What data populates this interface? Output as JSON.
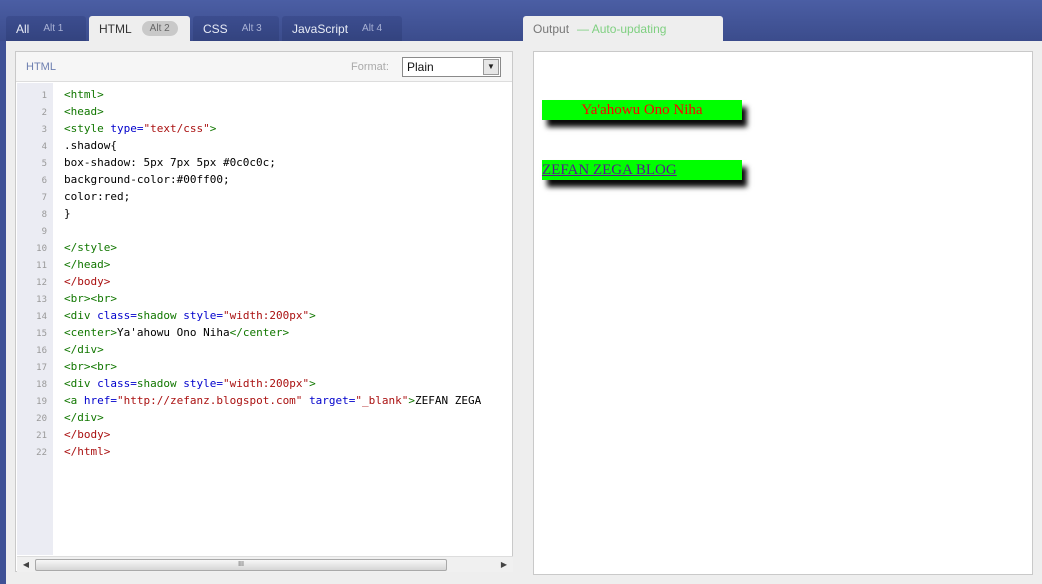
{
  "tabs": {
    "all": {
      "label": "All",
      "alt": "Alt 1"
    },
    "html": {
      "label": "HTML",
      "alt": "Alt 2"
    },
    "css": {
      "label": "CSS",
      "alt": "Alt 3"
    },
    "js": {
      "label": "JavaScript",
      "alt": "Alt 4"
    },
    "output": {
      "label": "Output",
      "status": "— Auto-updating"
    }
  },
  "editor": {
    "title": "HTML",
    "format_label": "Format:",
    "format_value": "Plain",
    "scroll_thumb": "III",
    "line_numbers": [
      "1",
      "2",
      "3",
      "4",
      "5",
      "6",
      "7",
      "8",
      "9",
      "10",
      "11",
      "12",
      "13",
      "14",
      "15",
      "16",
      "17",
      "18",
      "19",
      "20",
      "21",
      "22"
    ],
    "code_lines": [
      [
        {
          "c": "t-tag",
          "t": "<html>"
        }
      ],
      [
        {
          "c": "t-tag",
          "t": "<head>"
        }
      ],
      [
        {
          "c": "t-tag",
          "t": "<style "
        },
        {
          "c": "t-attr",
          "t": "type="
        },
        {
          "c": "t-str",
          "t": "\"text/css\""
        },
        {
          "c": "t-tag",
          "t": ">"
        }
      ],
      [
        {
          "c": "t-text",
          "t": ".shadow{"
        }
      ],
      [
        {
          "c": "t-text",
          "t": "box-shadow: 5px 7px 5px #0c0c0c;"
        }
      ],
      [
        {
          "c": "t-text",
          "t": "background-color:#00ff00;"
        }
      ],
      [
        {
          "c": "t-text",
          "t": "color:red;"
        }
      ],
      [
        {
          "c": "t-text",
          "t": "}"
        }
      ],
      [],
      [
        {
          "c": "t-tag",
          "t": "</style>"
        }
      ],
      [
        {
          "c": "t-tag",
          "t": "</head>"
        }
      ],
      [
        {
          "c": "t-kw",
          "t": "</body>"
        }
      ],
      [
        {
          "c": "t-tag",
          "t": "<br><br>"
        }
      ],
      [
        {
          "c": "t-tag",
          "t": "<div "
        },
        {
          "c": "t-attr",
          "t": "class="
        },
        {
          "c": "t-tag",
          "t": "shadow "
        },
        {
          "c": "t-attr",
          "t": "style="
        },
        {
          "c": "t-str",
          "t": "\"width:200px\""
        },
        {
          "c": "t-tag",
          "t": ">"
        }
      ],
      [
        {
          "c": "t-tag",
          "t": "<center>"
        },
        {
          "c": "t-text",
          "t": "Ya'ahowu Ono Niha"
        },
        {
          "c": "t-tag",
          "t": "</center>"
        }
      ],
      [
        {
          "c": "t-tag",
          "t": "</div>"
        }
      ],
      [
        {
          "c": "t-tag",
          "t": "<br><br>"
        }
      ],
      [
        {
          "c": "t-tag",
          "t": "<div "
        },
        {
          "c": "t-attr",
          "t": "class="
        },
        {
          "c": "t-tag",
          "t": "shadow "
        },
        {
          "c": "t-attr",
          "t": "style="
        },
        {
          "c": "t-str",
          "t": "\"width:200px\""
        },
        {
          "c": "t-tag",
          "t": ">"
        }
      ],
      [
        {
          "c": "t-tag",
          "t": "<a "
        },
        {
          "c": "t-attr",
          "t": "href="
        },
        {
          "c": "t-str",
          "t": "\"http://zefanz.blogspot.com\""
        },
        {
          "c": "t-text",
          "t": " "
        },
        {
          "c": "t-attr",
          "t": "target="
        },
        {
          "c": "t-str",
          "t": "\"_blank\""
        },
        {
          "c": "t-tag",
          "t": ">"
        },
        {
          "c": "t-text",
          "t": "ZEFAN ZEGA"
        }
      ],
      [
        {
          "c": "t-tag",
          "t": "</div>"
        }
      ],
      [
        {
          "c": "t-kw",
          "t": "</body>"
        }
      ],
      [
        {
          "c": "t-kw",
          "t": "</html>"
        }
      ]
    ]
  },
  "output": {
    "box1_text": "Ya'ahowu Ono Niha",
    "box2_link": "ZEFAN ZEGA BLOG",
    "box2_href": "http://zefanz.blogspot.com"
  }
}
